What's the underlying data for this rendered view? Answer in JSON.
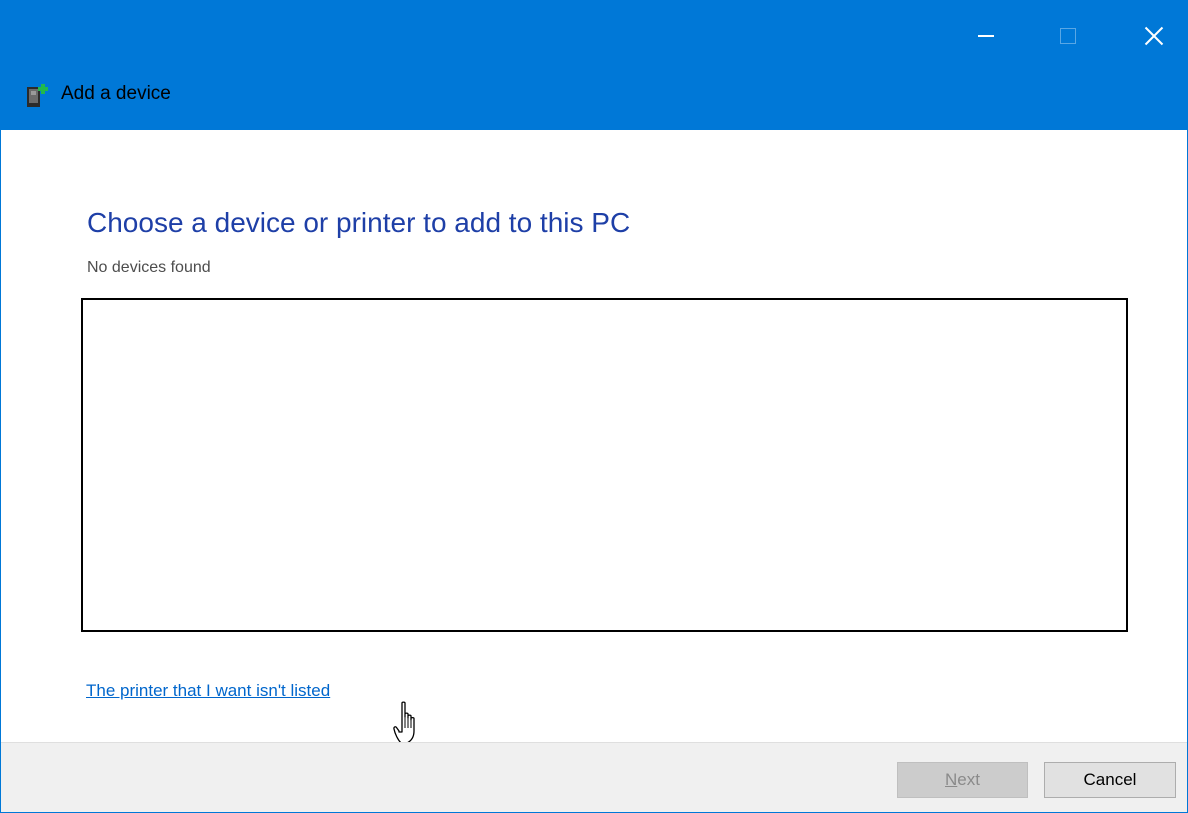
{
  "window": {
    "title": "Add a device",
    "accent_color": "#0078d7",
    "controls": {
      "minimize_icon": "minimize-icon",
      "maximize_icon": "maximize-icon",
      "close_icon": "close-icon"
    }
  },
  "main": {
    "heading": "Choose a device or printer to add to this PC",
    "status": "No devices found",
    "device_list": [],
    "link_printer_not_listed": "The printer that I want isn't listed",
    "heading_color": "#1e3fa7",
    "link_color": "#0066cc"
  },
  "footer": {
    "next_mnemonic": "N",
    "next_rest": "ext",
    "next_enabled": false,
    "cancel_label": "Cancel"
  }
}
